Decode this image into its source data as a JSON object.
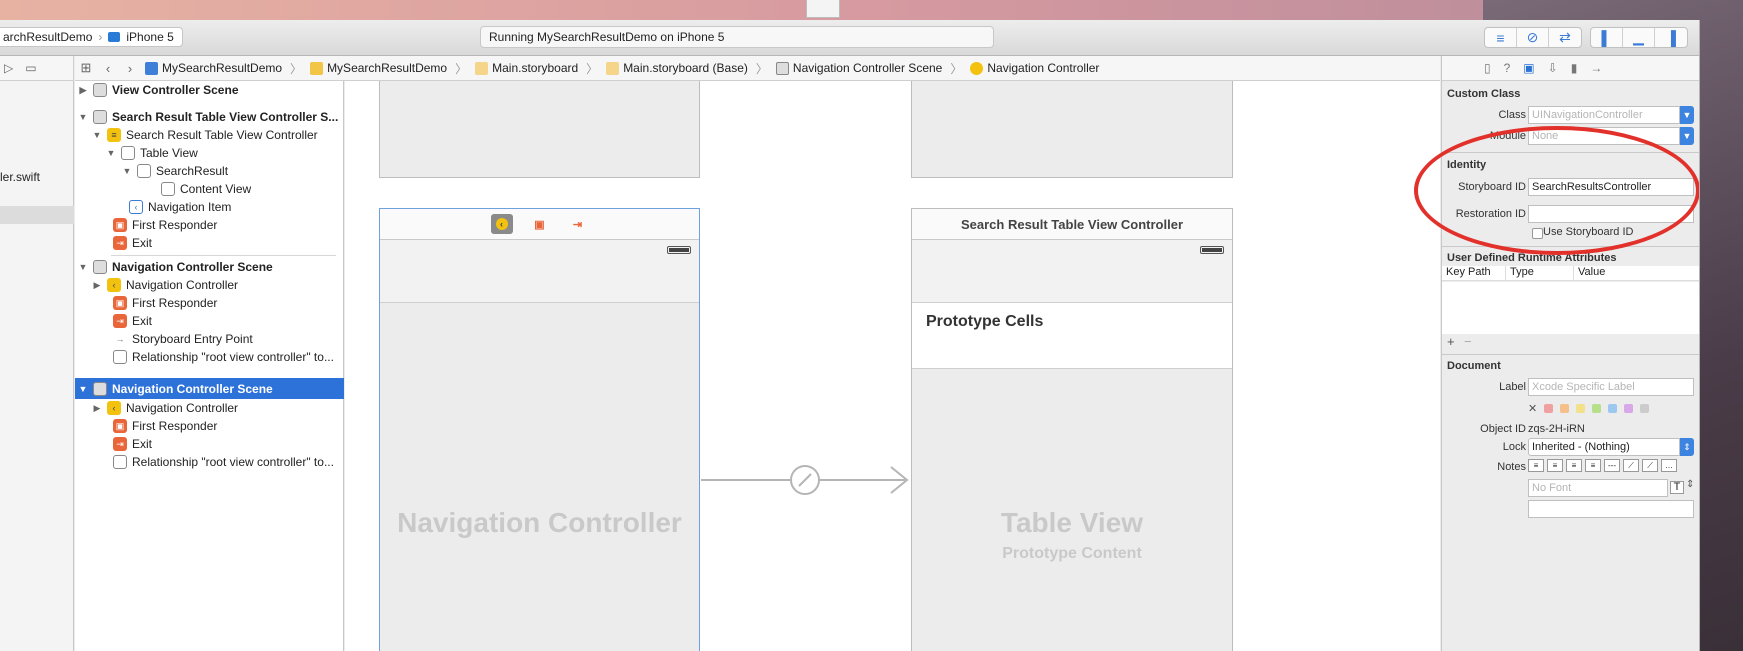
{
  "toolbar": {
    "scheme_name": "archResultDemo",
    "device": "iPhone 5",
    "activity_text": "Running MySearchResultDemo on iPhone 5",
    "editor_icons": [
      "standard-editor-icon",
      "assistant-editor-icon",
      "version-editor-icon"
    ],
    "view_icons": [
      "navigator-toggle-icon",
      "debug-area-toggle-icon",
      "utilities-toggle-icon"
    ]
  },
  "jumpbar": {
    "crumbs": [
      "MySearchResultDemo",
      "MySearchResultDemo",
      "Main.storyboard",
      "Main.storyboard (Base)",
      "Navigation Controller Scene",
      "Navigation Controller"
    ]
  },
  "navigator": {
    "file": "ler.swift"
  },
  "outline": {
    "rows": [
      {
        "label": "View Controller Scene"
      },
      {
        "label": "Search Result Table View Controller S..."
      },
      {
        "label": "Search Result Table View Controller"
      },
      {
        "label": "Table View"
      },
      {
        "label": "SearchResult"
      },
      {
        "label": "Content View"
      },
      {
        "label": "Navigation Item"
      },
      {
        "label": "First Responder"
      },
      {
        "label": "Exit"
      },
      {
        "label": "Navigation Controller Scene"
      },
      {
        "label": "Navigation Controller"
      },
      {
        "label": "First Responder"
      },
      {
        "label": "Exit"
      },
      {
        "label": "Storyboard Entry Point"
      },
      {
        "label": "Relationship \"root view controller\" to..."
      },
      {
        "label": "Navigation Controller Scene"
      },
      {
        "label": "Navigation Controller"
      },
      {
        "label": "First Responder"
      },
      {
        "label": "Exit"
      },
      {
        "label": "Relationship \"root view controller\" to..."
      }
    ]
  },
  "canvas": {
    "nav_controller_title": "Navigation Controller",
    "table_vc_bar_title": "Search Result Table View Controller",
    "prototype_cells": "Prototype Cells",
    "table_view_title": "Table View",
    "table_view_subtitle": "Prototype Content"
  },
  "inspector": {
    "custom_class_title": "Custom Class",
    "class_label": "Class",
    "class_placeholder": "UINavigationController",
    "module_label": "Module",
    "module_placeholder": "None",
    "identity_title": "Identity",
    "storyboard_id_label": "Storyboard ID",
    "storyboard_id_value": "SearchResultsController",
    "restoration_id_label": "Restoration ID",
    "restoration_id_value": "",
    "use_storyboard_id": "Use Storyboard ID",
    "udra_title": "User Defined Runtime Attributes",
    "col_key_path": "Key Path",
    "col_type": "Type",
    "col_value": "Value",
    "add_label": "+",
    "remove_label": "−",
    "document_title": "Document",
    "label_label": "Label",
    "label_placeholder": "Xcode Specific Label",
    "object_id_label": "Object ID",
    "object_id_value": "zqs-2H-iRN",
    "lock_label": "Lock",
    "lock_value": "Inherited - (Nothing)",
    "notes_label": "Notes",
    "font_placeholder": "No Font",
    "swatch_colors": [
      "#f0a0a0",
      "#f5c08a",
      "#f2e08a",
      "#b6e08c",
      "#9cc8f0",
      "#d8a8e8",
      "#cccccc"
    ]
  }
}
